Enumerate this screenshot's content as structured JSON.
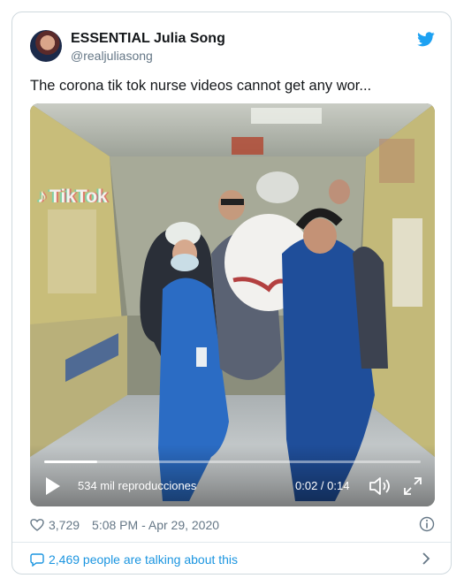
{
  "tweet": {
    "author": {
      "display_name": "ESSENTIAL Julia Song",
      "handle": "@realjuliasong"
    },
    "text": "The corona tik tok nurse videos cannot get any wor...",
    "likes": "3,729",
    "timestamp": "5:08 PM - Apr 29, 2020",
    "conversation_link": "2,469 people are talking about this"
  },
  "video": {
    "watermark": "TikTok",
    "views": "534 mil reproducciones",
    "time": "0:02 / 0:14",
    "progress_fraction": 0.14
  },
  "icons": {
    "brand": "twitter-bird-icon",
    "play": "play-icon",
    "volume": "volume-icon",
    "fullscreen": "fullscreen-icon",
    "like": "heart-icon",
    "info": "info-icon",
    "reply": "speech-bubble-icon",
    "navigate": "chevron-right-icon"
  },
  "colors": {
    "brand_blue": "#1da1f2",
    "link_blue": "#1b95e0",
    "muted": "#657786",
    "border": "#cfd9de"
  }
}
